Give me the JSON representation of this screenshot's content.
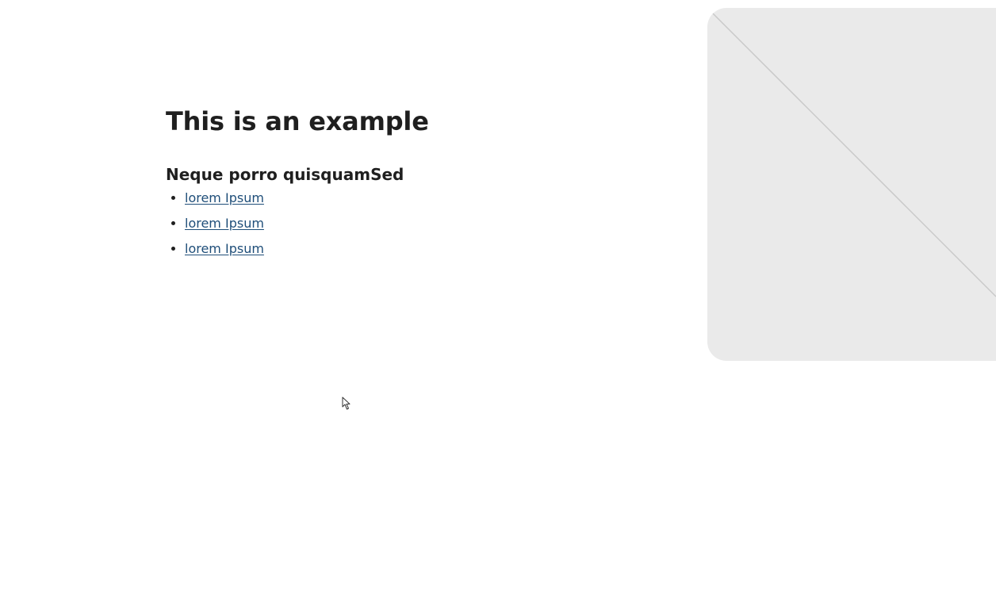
{
  "main": {
    "title": "This is an example",
    "section_heading": "Neque porro quisquamSed",
    "links": [
      {
        "label": "lorem Ipsum"
      },
      {
        "label": "lorem Ipsum"
      },
      {
        "label": "lorem Ipsum"
      }
    ]
  },
  "hero_image": {
    "icon": "image-placeholder-icon",
    "background_color": "#eaeaea",
    "line_color": "#c9c9c9"
  },
  "colors": {
    "text": "#1f1f1f",
    "link": "#1f4e79"
  }
}
